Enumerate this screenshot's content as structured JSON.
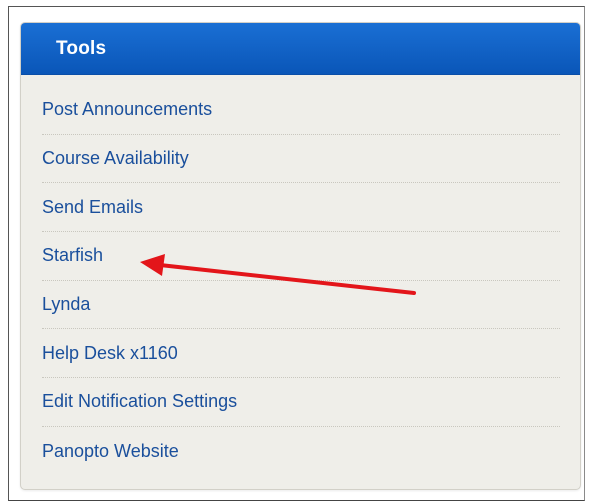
{
  "tools_panel": {
    "title": "Tools",
    "items": [
      {
        "label": "Post Announcements"
      },
      {
        "label": "Course Availability"
      },
      {
        "label": "Send Emails"
      },
      {
        "label": "Starfish"
      },
      {
        "label": "Lynda"
      },
      {
        "label": "Help Desk x1160"
      },
      {
        "label": "Edit Notification Settings"
      },
      {
        "label": "Panopto Website"
      }
    ]
  },
  "colors": {
    "header_blue": "#0a56b8",
    "link_blue": "#1a4f9c",
    "panel_background": "#efeee9",
    "annotation_arrow": "#e3151a"
  },
  "annotation": {
    "icon": "red-arrow-icon",
    "points_to": "Starfish"
  }
}
